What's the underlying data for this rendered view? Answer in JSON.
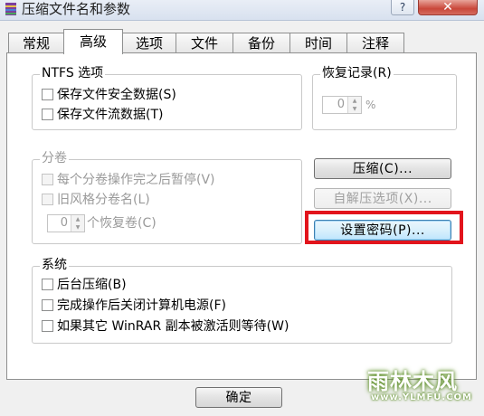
{
  "window": {
    "title": "压缩文件名和参数",
    "help_label": "?",
    "close_label": "✕"
  },
  "tabs": [
    {
      "label": "常规"
    },
    {
      "label": "高级"
    },
    {
      "label": "选项"
    },
    {
      "label": "文件"
    },
    {
      "label": "备份"
    },
    {
      "label": "时间"
    },
    {
      "label": "注释"
    }
  ],
  "active_tab": "高级",
  "ntfs": {
    "title": "NTFS 选项",
    "options": [
      {
        "label": "保存文件安全数据(S)",
        "checked": false
      },
      {
        "label": "保存文件流数据(T)",
        "checked": false
      }
    ]
  },
  "recovery": {
    "title": "恢复记录(R)",
    "value": "0",
    "unit": "%"
  },
  "volumes": {
    "title": "分卷",
    "options": [
      {
        "label": "每个分卷操作完之后暂停(V)",
        "checked": false,
        "enabled": false
      },
      {
        "label": "旧风格分卷名(L)",
        "checked": false,
        "enabled": false
      }
    ],
    "recovery_volumes": {
      "value": "0",
      "label": "个恢复卷(C)"
    }
  },
  "buttons": {
    "compression": "压缩(C)...",
    "sfx_options": "自解压选项(X)...",
    "set_password": "设置密码(P)...",
    "ok": "确定"
  },
  "system": {
    "title": "系统",
    "options": [
      {
        "label": "后台压缩(B)",
        "checked": false
      },
      {
        "label": "完成操作后关闭计算机电源(F)",
        "checked": false
      },
      {
        "label": "如果其它 WinRAR 副本被激活则等待(W)",
        "checked": false
      }
    ]
  },
  "watermark": {
    "text": "雨林木风",
    "url": "www.YLMFU.COM"
  },
  "colors": {
    "highlight": "#e2141c",
    "watermark": "#5e8f28"
  }
}
